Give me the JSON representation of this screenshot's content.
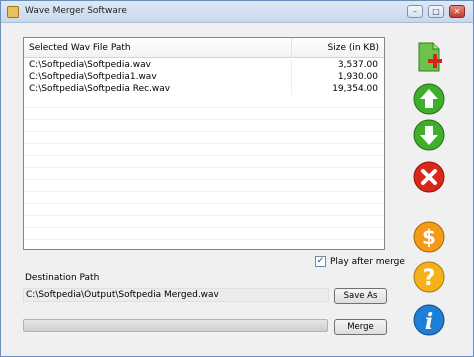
{
  "window": {
    "title": "Wave Merger Software"
  },
  "file_list": {
    "columns": [
      "Selected Wav File Path",
      "Size (in KB)"
    ],
    "rows": [
      {
        "path": "C:\\Softpedia\\Softpedia.wav",
        "size": "3,537.00"
      },
      {
        "path": "C:\\Softpedia\\Softpedia1.wav",
        "size": "1,930.00"
      },
      {
        "path": "C:\\Softpedia\\Softpedia Rec.wav",
        "size": "19,354.00"
      }
    ]
  },
  "options": {
    "play_after_merge_label": "Play after merge",
    "play_after_merge_checked": true
  },
  "destination": {
    "label": "Destination Path",
    "value": "C:\\Softpedia\\Output\\Softpedia Merged.wav",
    "save_as_label": "Save As"
  },
  "merge": {
    "button_label": "Merge",
    "progress": 0
  },
  "side_toolbar": {
    "icons": [
      "add-file-icon",
      "move-up-icon",
      "move-down-icon",
      "remove-icon",
      "buy-icon",
      "help-icon",
      "info-icon"
    ]
  }
}
